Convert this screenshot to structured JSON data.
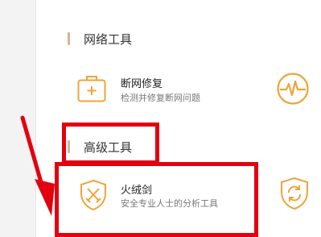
{
  "sections": [
    {
      "title": "网络工具",
      "tools": [
        {
          "name": "断网修复",
          "description": "检测并修复断网问题",
          "icon": "medical-kit-icon",
          "side_icon": "heartbeat-icon"
        }
      ]
    },
    {
      "title": "高级工具",
      "tools": [
        {
          "name": "火绒剑",
          "description": "安全专业人士的分析工具",
          "icon": "crossed-swords-shield-icon",
          "side_icon": "refresh-shield-icon"
        }
      ]
    }
  ],
  "colors": {
    "accent": "#f0a33b",
    "section_bar": "#d5b596",
    "annotation_red": "#e3000f",
    "text_primary": "#222222",
    "text_secondary": "#777777",
    "sidebar_bg": "#f3f3f3"
  }
}
